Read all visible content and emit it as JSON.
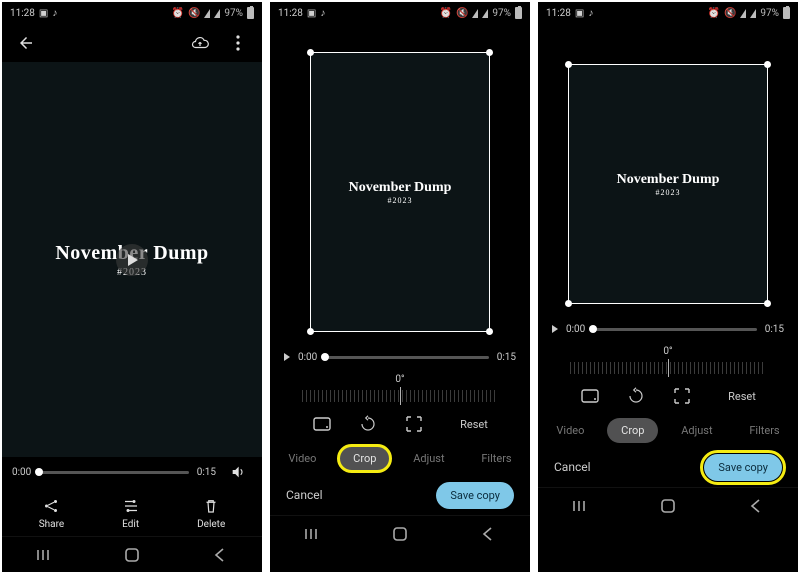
{
  "status": {
    "time": "11:28",
    "battery_pct": "97%"
  },
  "video": {
    "title": "November Dump",
    "subtitle": "#2023"
  },
  "view": {
    "time_start": "0:00",
    "time_end": "0:15",
    "actions": {
      "share": "Share",
      "edit": "Edit",
      "delete": "Delete"
    }
  },
  "edit": {
    "time_start": "0:00",
    "time_end": "0:15",
    "angle": "0°",
    "reset": "Reset",
    "tabs": {
      "video": "Video",
      "crop": "Crop",
      "adjust": "Adjust",
      "filters": "Filters"
    },
    "cancel": "Cancel",
    "save_copy": "Save copy"
  }
}
